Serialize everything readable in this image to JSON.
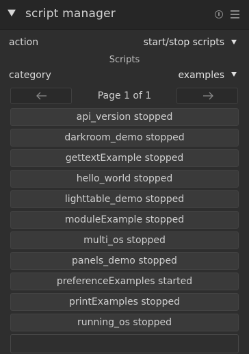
{
  "header": {
    "title": "script manager",
    "icons": [
      "collapse-arrow-icon",
      "reset-icon",
      "presets-menu-icon"
    ]
  },
  "action": {
    "label": "action",
    "value": "start/stop scripts"
  },
  "section_title": "Scripts",
  "category": {
    "label": "category",
    "value": "examples"
  },
  "pagination": {
    "prev_icon": "arrow-left-icon",
    "next_icon": "arrow-right-icon",
    "page_label": "Page 1 of 1"
  },
  "scripts": [
    "api_version stopped",
    "darkroom_demo stopped",
    "gettextExample stopped",
    "hello_world stopped",
    "lighttable_demo stopped",
    "moduleExample stopped",
    "multi_os stopped",
    "panels_demo stopped",
    "preferenceExamples started",
    "printExamples stopped",
    "running_os stopped",
    ""
  ]
}
